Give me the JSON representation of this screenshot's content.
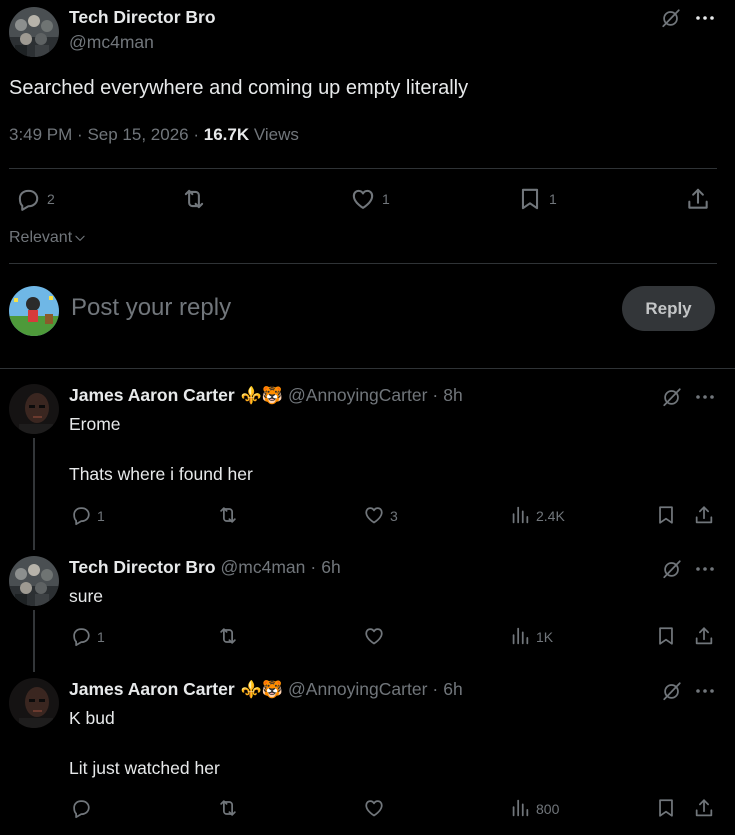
{
  "main_post": {
    "author_name": "Tech Director Bro",
    "author_handle": "@mc4man",
    "text": "Searched everywhere and coming up empty literally",
    "time": "3:49 PM",
    "date": "Sep 15, 2026",
    "views_count": "16.7K",
    "views_label": "Views",
    "replies": "2",
    "likes": "1",
    "bookmarks": "1",
    "sort_label": "Relevant"
  },
  "composer": {
    "placeholder": "Post your reply",
    "button_label": "Reply"
  },
  "replies": [
    {
      "author_name": "James Aaron Carter",
      "emoji": "⚜️🐯",
      "author_handle": "@AnnoyingCarter",
      "time": "8h",
      "lines": [
        "Erome",
        "Thats where i found her"
      ],
      "replies": "1",
      "reposts": "",
      "likes": "3",
      "views": "2.4K"
    },
    {
      "author_name": "Tech Director Bro",
      "author_handle": "@mc4man",
      "time": "6h",
      "lines": [
        "sure"
      ],
      "replies": "1",
      "reposts": "",
      "likes": "",
      "views": "1K"
    },
    {
      "author_name": "James Aaron Carter",
      "emoji": "⚜️🐯",
      "author_handle": "@AnnoyingCarter",
      "time": "6h",
      "lines": [
        "K bud",
        "Lit just watched her"
      ],
      "replies": "",
      "reposts": "",
      "likes": "",
      "views": "800"
    }
  ],
  "separator": "·",
  "icons": {
    "grok": "grok-icon",
    "more": "more-icon",
    "reply": "reply-icon",
    "repost": "repost-icon",
    "like": "like-icon",
    "bookmark": "bookmark-icon",
    "share": "share-icon",
    "views": "views-icon",
    "chevron": "chevron-down-icon"
  },
  "colors": {
    "background": "#000000",
    "text": "#e7e9ea",
    "muted": "#71767b",
    "divider": "#2f3336",
    "button_bg": "#333639"
  }
}
